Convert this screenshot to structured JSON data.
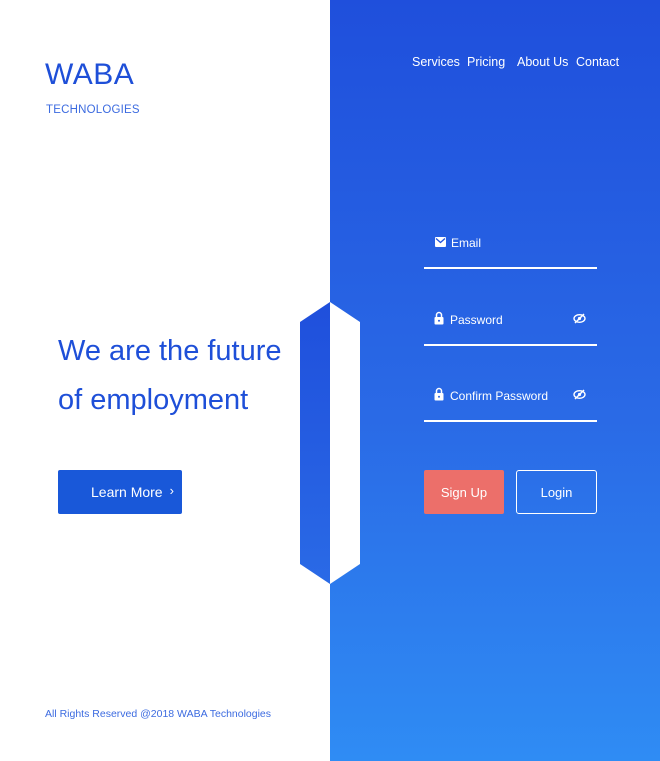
{
  "brand": {
    "title": "WABA",
    "subtitle": "TECHNOLOGIES"
  },
  "hero": {
    "line1": "We are the future",
    "line2": "of employment"
  },
  "learn_more": {
    "label": "Learn More",
    "chevron": "›"
  },
  "footer": {
    "text": "All Rights Reserved @2018 WABA Technologies"
  },
  "nav": {
    "items": [
      "Services",
      "Pricing",
      "About Us",
      "Contact"
    ]
  },
  "form": {
    "email_label": "Email",
    "password_label": "Password",
    "confirm_label": "Confirm Password",
    "signup_label": "Sign Up",
    "login_label": "Login"
  },
  "icons": {
    "email": "envelope-icon",
    "password": "lock-icon",
    "visibility": "eye-off-icon"
  },
  "colors": {
    "brand_blue": "#1e4fd8",
    "gradient_top": "#1f4fdc",
    "gradient_bottom": "#2f8cf4",
    "signup": "#ec6f6a"
  }
}
